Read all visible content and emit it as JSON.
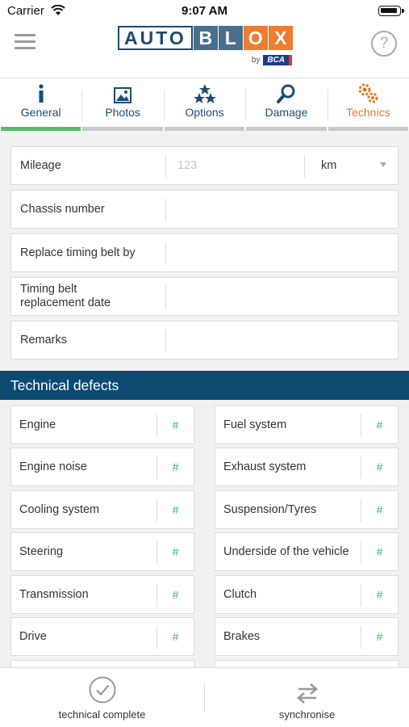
{
  "status_bar": {
    "carrier": "Carrier",
    "time": "9:07 AM"
  },
  "header": {
    "logo": {
      "word": "AUTO",
      "boxes": [
        "B",
        "L",
        "O",
        "X"
      ],
      "by": "by",
      "brand": "BCA"
    },
    "help_glyph": "?"
  },
  "tabs": [
    {
      "label": "General",
      "icon": "info-icon"
    },
    {
      "label": "Photos",
      "icon": "photo-icon"
    },
    {
      "label": "Options",
      "icon": "stars-icon"
    },
    {
      "label": "Damage",
      "icon": "magnifier-icon"
    },
    {
      "label": "Technics",
      "icon": "gears-icon"
    }
  ],
  "form": {
    "mileage": {
      "label": "Mileage",
      "placeholder": "123",
      "unit": "km"
    },
    "chassis": {
      "label": "Chassis number",
      "value": ""
    },
    "timing_belt": {
      "label": "Replace timing belt by",
      "value": ""
    },
    "timing_date": {
      "label": "Timing belt replacement date",
      "value": ""
    },
    "remarks": {
      "label": "Remarks",
      "value": ""
    }
  },
  "defects_section": {
    "title": "Technical defects",
    "hash": "#",
    "left": [
      "Engine",
      "Engine noise",
      "Cooling system",
      "Steering",
      "Transmission",
      "Drive"
    ],
    "right": [
      "Fuel system",
      "Exhaust system",
      "Suspension/Tyres",
      "Underside of the vehicle",
      "Clutch",
      "Brakes"
    ]
  },
  "bottom": {
    "complete_label": "technical complete",
    "sync_label": "synchronise"
  },
  "colors": {
    "brand_blue": "#0d4a72",
    "logo_blue": "#4a6f8c",
    "logo_orange": "#ee7d32",
    "active_tab": "#5cb86b",
    "technics_orange": "#e07a22",
    "hash_green": "#3bb66a"
  }
}
